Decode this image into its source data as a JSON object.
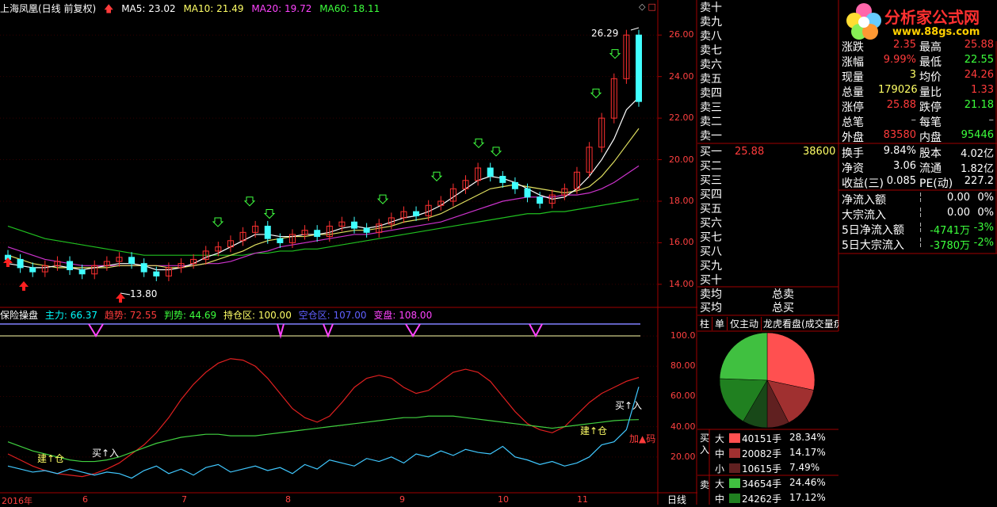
{
  "header": {
    "stock": "上海凤凰(日线 前复权)",
    "ma5": "MA5: 23.02",
    "ma10": "MA10: 21.49",
    "ma20": "MA20: 19.72",
    "ma60": "MA60: 18.11"
  },
  "price_axis": [
    "26.00",
    "24.00",
    "22.00",
    "20.00",
    "18.00",
    "16.00",
    "14.00"
  ],
  "price_high": "26.29",
  "price_low": "13.80",
  "indicator": {
    "name": "保险操盘",
    "zhuli": "主力: 66.37",
    "qushi": "趋势: 72.55",
    "panduan": "判势: 44.69",
    "chicang": "持仓区: 100.00",
    "kongcang": "空仓区: 107.00",
    "bianpan": "变盘: 108.00"
  },
  "ind_axis": [
    "100.0",
    "80.00",
    "60.00",
    "40.00",
    "20.00"
  ],
  "annotations": {
    "jiancang1": "建↑仓",
    "mairu1": "买↑入",
    "jiancang2": "建↑仓",
    "mairu2": "买↑入",
    "jiama": "加▲码"
  },
  "x_labels": [
    "2016年",
    "6",
    "7",
    "8",
    "9",
    "10",
    "11"
  ],
  "period_label": "日线",
  "orderbook": {
    "sell": [
      "卖十",
      "卖九",
      "卖八",
      "卖七",
      "卖六",
      "卖五",
      "卖四",
      "卖三",
      "卖二",
      "卖一"
    ],
    "buy": [
      "买一",
      "买二",
      "买三",
      "买四",
      "买五",
      "买六",
      "买七",
      "买八",
      "买九",
      "买十"
    ],
    "buy1_price": "25.88",
    "buy1_vol": "38600",
    "avg_sell": "卖均",
    "avg_buy": "买均",
    "total_sell": "总卖",
    "total_buy": "总买"
  },
  "tabs": [
    "柱",
    "单",
    "仅主动",
    "龙虎看盘(成交量疠"
  ],
  "logo": {
    "name": "分析家公式网",
    "url": "www.88gs.com"
  },
  "quote": [
    {
      "l1": "涨跌",
      "v1": "2.35",
      "l2": "最高",
      "v2": "25.88",
      "c1": "red",
      "c2": "red"
    },
    {
      "l1": "涨幅",
      "v1": "9.99%",
      "l2": "最低",
      "v2": "22.55",
      "c1": "red",
      "c2": "grn"
    },
    {
      "l1": "现量",
      "v1": "3",
      "l2": "均价",
      "v2": "24.26",
      "c1": "yel",
      "c2": "red"
    },
    {
      "l1": "总量",
      "v1": "179026",
      "l2": "量比",
      "v2": "1.33",
      "c1": "yel",
      "c2": "red"
    },
    {
      "l1": "涨停",
      "v1": "25.88",
      "l2": "跌停",
      "v2": "21.18",
      "c1": "red",
      "c2": "grn"
    },
    {
      "l1": "总笔",
      "v1": "–",
      "l2": "每笔",
      "v2": "–",
      "c1": "gry",
      "c2": "gry"
    },
    {
      "l1": "外盘",
      "v1": "83580",
      "l2": "内盘",
      "v2": "95446",
      "c1": "red",
      "c2": "grn"
    }
  ],
  "quote2": [
    {
      "l1": "换手",
      "v1": "9.84%",
      "l2": "股本",
      "v2": "4.02亿"
    },
    {
      "l1": "净资",
      "v1": "3.06",
      "l2": "流通",
      "v2": "1.82亿"
    },
    {
      "l1": "收益(三)",
      "v1": "0.085",
      "l2": "PE(动)",
      "v2": "227.2"
    }
  ],
  "flow": [
    {
      "l": "净流入额",
      "v": "0.00",
      "p": "0%",
      "c": "wht"
    },
    {
      "l": "大宗流入",
      "v": "0.00",
      "p": "0%",
      "c": "wht"
    },
    {
      "l": "5日净流入额",
      "v": "-4741万",
      "p": "-3%",
      "c": "grn"
    },
    {
      "l": "5日大宗流入",
      "v": "-3780万",
      "p": "-2%",
      "c": "grn"
    }
  ],
  "deal_table": {
    "buy_side": "买入",
    "sell_side": "卖",
    "rows": [
      {
        "size": "大",
        "qty": "40151手",
        "pct": "28.34%",
        "color": "#ff5050"
      },
      {
        "size": "中",
        "qty": "20082手",
        "pct": "14.17%",
        "color": "#a03030"
      },
      {
        "size": "小",
        "qty": "10615手",
        "pct": "7.49%",
        "color": "#602020"
      },
      {
        "size": "大",
        "qty": "34654手",
        "pct": "24.46%",
        "color": "#40c040"
      },
      {
        "size": "中",
        "qty": "24262手",
        "pct": "17.12%",
        "color": "#208020"
      }
    ]
  },
  "chart_data": {
    "type": "line",
    "title": "上海凤凰(日线 前复权)",
    "ylim": [
      13.5,
      27
    ],
    "x": [
      "2016年",
      "6",
      "7",
      "8",
      "9",
      "10",
      "11"
    ],
    "close": [
      15.2,
      14.8,
      14.6,
      14.9,
      15.1,
      14.7,
      14.5,
      14.9,
      15.1,
      15.3,
      15.0,
      14.6,
      14.4,
      14.8,
      15.0,
      15.2,
      15.6,
      15.8,
      16.1,
      16.5,
      16.8,
      16.2,
      16.0,
      16.4,
      16.6,
      16.3,
      16.8,
      17.0,
      16.7,
      16.5,
      16.9,
      17.2,
      17.5,
      17.3,
      17.8,
      18.0,
      18.6,
      19.0,
      19.6,
      19.2,
      18.9,
      18.6,
      18.2,
      17.9,
      18.3,
      18.6,
      19.4,
      20.6,
      22.0,
      23.9,
      26.0,
      22.8
    ],
    "ma5": [
      15.0,
      14.9,
      14.8,
      14.8,
      14.9,
      14.8,
      14.7,
      14.8,
      14.9,
      15.0,
      15.0,
      14.9,
      14.7,
      14.7,
      14.8,
      15.0,
      15.3,
      15.5,
      15.8,
      16.1,
      16.4,
      16.4,
      16.3,
      16.3,
      16.4,
      16.4,
      16.5,
      16.7,
      16.8,
      16.7,
      16.8,
      17.0,
      17.2,
      17.3,
      17.5,
      17.8,
      18.2,
      18.6,
      19.0,
      19.2,
      19.1,
      18.9,
      18.6,
      18.3,
      18.1,
      18.2,
      18.6,
      19.2,
      20.0,
      21.0,
      22.4,
      23.0
    ],
    "ma10": [
      15.4,
      15.2,
      15.0,
      14.9,
      14.8,
      14.8,
      14.8,
      14.8,
      14.8,
      14.9,
      14.9,
      14.9,
      14.9,
      14.8,
      14.8,
      14.9,
      15.0,
      15.2,
      15.4,
      15.6,
      15.9,
      16.1,
      16.2,
      16.3,
      16.3,
      16.4,
      16.4,
      16.5,
      16.6,
      16.6,
      16.7,
      16.8,
      17.0,
      17.1,
      17.2,
      17.4,
      17.7,
      18.0,
      18.3,
      18.6,
      18.7,
      18.8,
      18.7,
      18.6,
      18.5,
      18.4,
      18.5,
      18.7,
      19.2,
      19.9,
      20.7,
      21.5
    ],
    "ma20": [
      15.8,
      15.6,
      15.4,
      15.2,
      15.1,
      15.0,
      14.9,
      14.9,
      14.9,
      14.9,
      14.9,
      14.9,
      14.9,
      14.9,
      14.9,
      14.9,
      15.0,
      15.0,
      15.1,
      15.3,
      15.5,
      15.6,
      15.8,
      15.9,
      16.0,
      16.1,
      16.2,
      16.3,
      16.4,
      16.4,
      16.5,
      16.6,
      16.7,
      16.8,
      16.9,
      17.0,
      17.2,
      17.4,
      17.6,
      17.8,
      18.0,
      18.1,
      18.2,
      18.2,
      18.2,
      18.3,
      18.3,
      18.4,
      18.6,
      18.9,
      19.3,
      19.7
    ],
    "ma60": [
      16.8,
      16.6,
      16.4,
      16.2,
      16.1,
      16.0,
      15.9,
      15.8,
      15.7,
      15.6,
      15.5,
      15.4,
      15.4,
      15.4,
      15.4,
      15.4,
      15.4,
      15.4,
      15.4,
      15.4,
      15.5,
      15.5,
      15.6,
      15.6,
      15.7,
      15.7,
      15.8,
      15.9,
      16.0,
      16.1,
      16.2,
      16.3,
      16.4,
      16.5,
      16.6,
      16.7,
      16.8,
      16.9,
      17.0,
      17.1,
      17.2,
      17.3,
      17.4,
      17.4,
      17.5,
      17.5,
      17.6,
      17.7,
      17.8,
      17.9,
      18.0,
      18.11
    ],
    "indicator": {
      "ylim": [
        0,
        110
      ],
      "zhuli": [
        22,
        18,
        14,
        11,
        9,
        8,
        7,
        9,
        12,
        16,
        22,
        28,
        36,
        46,
        58,
        68,
        76,
        82,
        85,
        84,
        80,
        72,
        62,
        52,
        46,
        43,
        47,
        56,
        66,
        72,
        74,
        72,
        66,
        62,
        64,
        70,
        76,
        78,
        76,
        70,
        60,
        50,
        42,
        38,
        36,
        40,
        48,
        56,
        62,
        66,
        70,
        72.55
      ],
      "qushi": [
        30,
        27,
        24,
        22,
        20,
        18,
        17,
        17,
        18,
        20,
        23,
        26,
        29,
        31,
        33,
        34,
        35,
        35,
        34,
        34,
        34,
        35,
        36,
        37,
        38,
        39,
        40,
        41,
        42,
        43,
        44,
        45,
        46,
        46,
        47,
        47,
        47,
        46,
        45,
        44,
        43,
        42,
        41,
        40,
        39,
        40,
        41,
        42,
        43,
        44,
        44.5,
        44.69
      ],
      "panduan": [
        14,
        12,
        10,
        11,
        9,
        12,
        10,
        8,
        10,
        9,
        6,
        11,
        14,
        9,
        12,
        8,
        13,
        15,
        10,
        12,
        14,
        11,
        13,
        9,
        15,
        12,
        18,
        16,
        14,
        19,
        17,
        20,
        16,
        22,
        20,
        24,
        21,
        25,
        23,
        22,
        27,
        20,
        18,
        15,
        17,
        14,
        16,
        20,
        28,
        30,
        38,
        66.37
      ]
    }
  }
}
